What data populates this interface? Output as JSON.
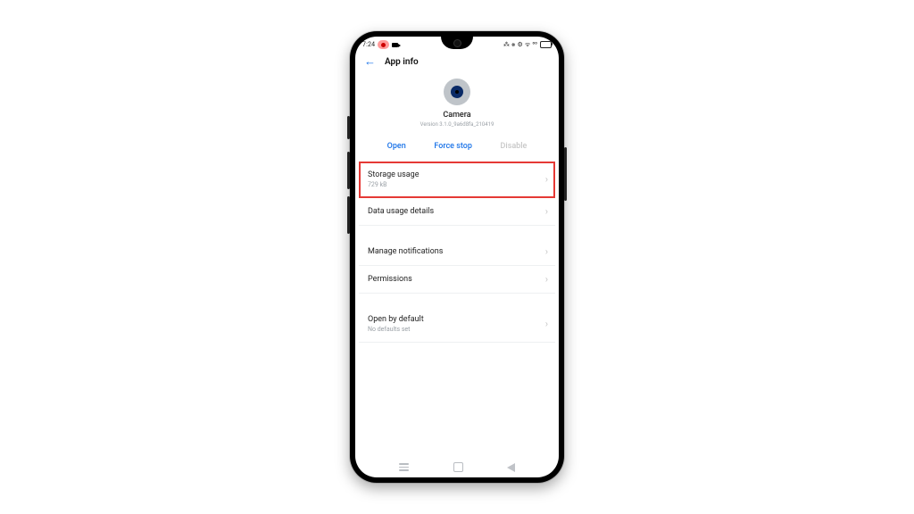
{
  "status": {
    "time": "7:24",
    "icons": "⁂ ⨳ ⚙ ᯤ ⁰⁰"
  },
  "header": {
    "title": "App info"
  },
  "app": {
    "name": "Camera",
    "version": "Version 3.1.0_9a6d8fa_210419"
  },
  "actions": {
    "open": "Open",
    "force_stop": "Force stop",
    "disable": "Disable"
  },
  "rows": {
    "storage": {
      "title": "Storage usage",
      "sub": "729 kB"
    },
    "data": {
      "title": "Data usage details"
    },
    "notifications": {
      "title": "Manage notifications"
    },
    "permissions": {
      "title": "Permissions"
    },
    "defaults": {
      "title": "Open by default",
      "sub": "No defaults set"
    }
  }
}
